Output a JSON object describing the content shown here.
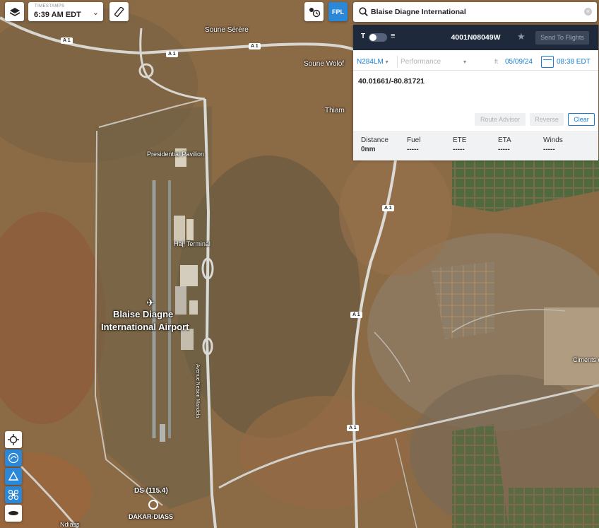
{
  "toolbar": {
    "layers_icon": "layers-icon",
    "timestamps_label": "TIMESTAMPS",
    "timestamp_value": "6:39 AM EDT",
    "ruler_icon": "ruler-icon",
    "weather_icon": "weather-clock-icon",
    "fpl_label": "FPL"
  },
  "search": {
    "icon": "search-icon",
    "value": "Blaise Diagne International",
    "clear_icon": "clear-icon"
  },
  "flight_panel": {
    "toggle_icon": "text-toggle-icon",
    "waypoint_title": "4001N08049W",
    "star_icon": "star-icon",
    "send_to_flights": "Send To Flights",
    "aircraft": "N284LM",
    "performance_placeholder": "Performance",
    "ft_label": "ft",
    "date": "05/09/24",
    "time": "08:38 EDT",
    "route_text": "40.01661/-80.81721",
    "route_advisor": "Route Advisor",
    "reverse": "Reverse",
    "clear": "Clear",
    "stats": [
      {
        "label": "Distance",
        "value": "0nm"
      },
      {
        "label": "Fuel",
        "value": "-----"
      },
      {
        "label": "ETE",
        "value": "-----"
      },
      {
        "label": "ETA",
        "value": "-----"
      },
      {
        "label": "Winds",
        "value": "-----"
      }
    ]
  },
  "side_tools": [
    "recenter-icon",
    "route-icon",
    "triangle-icon",
    "drone-icon",
    "ellipse-icon"
  ],
  "map_labels": {
    "soune_serere": "Soune Sérère",
    "soune_wolof": "Soune Wolof",
    "thiam": "Thiam",
    "presidential": "Presidential Pavilion",
    "hajj": "Hajj Terminal",
    "airport_line1": "Blaise Diagne",
    "airport_line2": "International Airport",
    "ciments": "Ciments du Sa",
    "ds": "DS (115.4)",
    "dakar_diass": "DAKAR-DIASS",
    "ndiass": "Ndiass",
    "road": "A 1",
    "avenue": "Avenue Nelson Mandela"
  },
  "colors": {
    "map_ground": "#8a6a45",
    "panel_header": "#1e2a3c",
    "accent_blue": "#1a7fd4",
    "fpl_blue": "#2b87d8"
  }
}
